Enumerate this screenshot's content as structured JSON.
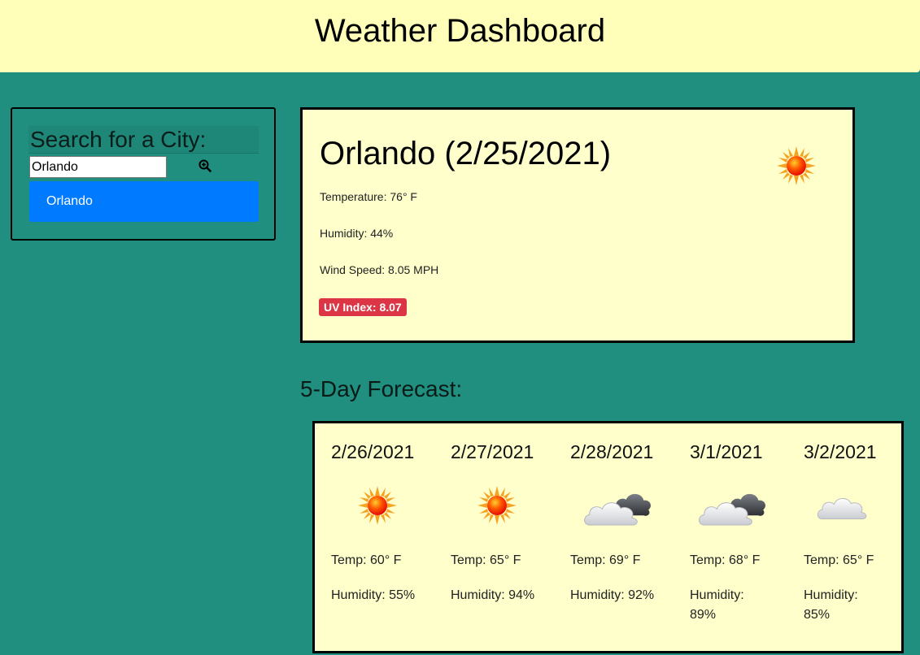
{
  "header": {
    "title": "Weather Dashboard"
  },
  "search": {
    "title": "Search for a City:",
    "input_value": "Orlando",
    "button_icon": "search-plus-icon",
    "history": [
      "Orlando"
    ]
  },
  "current": {
    "title": "Orlando (2/25/2021)",
    "icon": "sun-icon",
    "temperature": "Temperature: 76° F",
    "humidity": "Humidity: 44%",
    "wind": "Wind Speed: 8.05 MPH",
    "uv": "UV Index: 8.07",
    "uv_color": "#dc3545"
  },
  "forecast": {
    "heading": "5-Day Forecast:",
    "days": [
      {
        "date": "2/26/2021",
        "icon": "sun-icon",
        "temp": "Temp: 60° F",
        "humidity": "Humidity: 55%"
      },
      {
        "date": "2/27/2021",
        "icon": "sun-icon",
        "temp": "Temp: 65° F",
        "humidity": "Humidity: 94%"
      },
      {
        "date": "2/28/2021",
        "icon": "cloudy-icon",
        "temp": "Temp: 69° F",
        "humidity": "Humidity: 92%"
      },
      {
        "date": "3/1/2021",
        "icon": "cloudy-icon",
        "temp": "Temp: 68° F",
        "humidity": "Humidity: 89%"
      },
      {
        "date": "3/2/2021",
        "icon": "cloud-icon",
        "temp": "Temp: 65° F",
        "humidity": "Humidity: 85%"
      }
    ]
  },
  "colors": {
    "background": "#208f80",
    "header": "#ffffb9",
    "card": "#ffffcc",
    "history_button": "#007bff"
  }
}
